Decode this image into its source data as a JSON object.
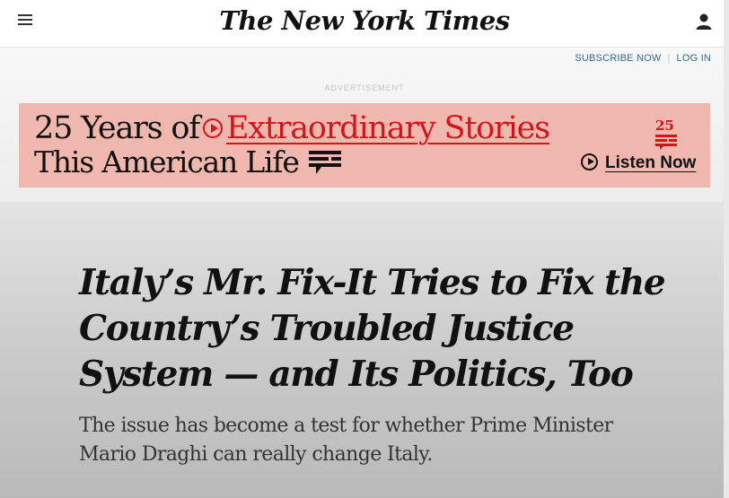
{
  "masthead": {
    "logo": "The New York Times",
    "menu_icon": "hamburger-menu-icon",
    "account_icon": "user-icon"
  },
  "account_links": {
    "subscribe": "SUBSCRIBE NOW",
    "login": "LOG IN"
  },
  "ad": {
    "label": "ADVERTISEMENT",
    "line1_start": "25 Years of",
    "line1_highlight": "Extraordinary Stories",
    "line2": "This American Life",
    "badge": "25",
    "cta": "Listen Now",
    "background": "#efb7ae",
    "accent": "#d2141b"
  },
  "article": {
    "headline": "Italy’s Mr. Fix-It Tries to Fix the Country’s Troubled Justice System — and Its Politics, Too",
    "summary": "The issue has become a test for whether Prime Minister Mario Draghi can really change Italy."
  }
}
